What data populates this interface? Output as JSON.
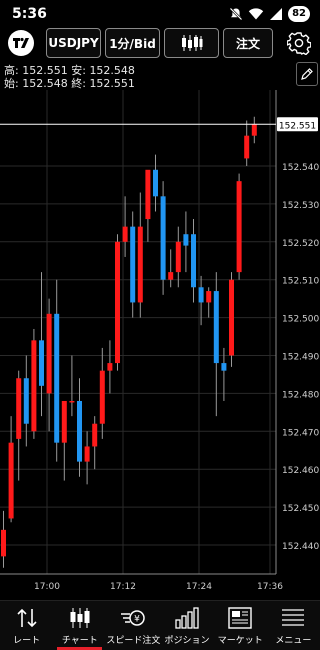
{
  "status": {
    "time": "5:36",
    "battery": "82"
  },
  "toolbar": {
    "symbol": "USDJPY",
    "timeframe": "1分/Bid",
    "order": "注文"
  },
  "ohlc": {
    "high_label": "高:",
    "high": "152.551",
    "low_label": "安:",
    "low": "152.548",
    "open_label": "始:",
    "open": "152.548",
    "close_label": "終:",
    "close": "152.551"
  },
  "colors": {
    "up": "#ff1a1a",
    "down": "#2196f3",
    "grid": "#2a2a2a",
    "accent": "#e6202a"
  },
  "chart_data": {
    "type": "candlestick",
    "current_price": "152.551",
    "y_ticks": [
      "152.540",
      "152.530",
      "152.520",
      "152.510",
      "152.500",
      "152.490",
      "152.480",
      "152.470",
      "152.460",
      "152.450",
      "152.440"
    ],
    "x_ticks": [
      "17:00",
      "17:12",
      "17:24",
      "17:36"
    ],
    "candles": [
      {
        "o": 152.437,
        "h": 152.449,
        "c": 152.444,
        "l": 152.434
      },
      {
        "o": 152.447,
        "h": 152.474,
        "c": 152.467,
        "l": 152.446
      },
      {
        "o": 152.468,
        "h": 152.486,
        "c": 152.484,
        "l": 152.457
      },
      {
        "o": 152.484,
        "h": 152.49,
        "c": 152.472,
        "l": 152.466
      },
      {
        "o": 152.47,
        "h": 152.497,
        "c": 152.494,
        "l": 152.468
      },
      {
        "o": 152.494,
        "h": 152.512,
        "c": 152.482,
        "l": 152.474
      },
      {
        "o": 152.48,
        "h": 152.505,
        "c": 152.501,
        "l": 152.47
      },
      {
        "o": 152.501,
        "h": 152.51,
        "c": 152.467,
        "l": 152.462
      },
      {
        "o": 152.467,
        "h": 152.476,
        "c": 152.478,
        "l": 152.457
      },
      {
        "o": 152.478,
        "h": 152.49,
        "c": 152.478,
        "l": 152.474
      },
      {
        "o": 152.478,
        "h": 152.484,
        "c": 152.462,
        "l": 152.458
      },
      {
        "o": 152.462,
        "h": 152.47,
        "c": 152.466,
        "l": 152.456
      },
      {
        "o": 152.466,
        "h": 152.474,
        "c": 152.472,
        "l": 152.46
      },
      {
        "o": 152.472,
        "h": 152.492,
        "c": 152.486,
        "l": 152.468
      },
      {
        "o": 152.486,
        "h": 152.494,
        "c": 152.488,
        "l": 152.48
      },
      {
        "o": 152.488,
        "h": 152.522,
        "c": 152.52,
        "l": 152.486
      },
      {
        "o": 152.52,
        "h": 152.532,
        "c": 152.524,
        "l": 152.516
      },
      {
        "o": 152.524,
        "h": 152.528,
        "c": 152.504,
        "l": 152.5
      },
      {
        "o": 152.504,
        "h": 152.533,
        "c": 152.524,
        "l": 152.5
      },
      {
        "o": 152.526,
        "h": 152.538,
        "c": 152.539,
        "l": 152.52
      },
      {
        "o": 152.539,
        "h": 152.543,
        "c": 152.532,
        "l": 152.528
      },
      {
        "o": 152.532,
        "h": 152.536,
        "c": 152.51,
        "l": 152.506
      },
      {
        "o": 152.51,
        "h": 152.518,
        "c": 152.512,
        "l": 152.508
      },
      {
        "o": 152.512,
        "h": 152.524,
        "c": 152.52,
        "l": 152.508
      },
      {
        "o": 152.522,
        "h": 152.528,
        "c": 152.519,
        "l": 152.512
      },
      {
        "o": 152.522,
        "h": 152.526,
        "c": 152.508,
        "l": 152.504
      },
      {
        "o": 152.508,
        "h": 152.511,
        "c": 152.504,
        "l": 152.498
      },
      {
        "o": 152.504,
        "h": 152.508,
        "c": 152.507,
        "l": 152.5
      },
      {
        "o": 152.507,
        "h": 152.512,
        "c": 152.488,
        "l": 152.474
      },
      {
        "o": 152.488,
        "h": 152.492,
        "c": 152.486,
        "l": 152.478
      },
      {
        "o": 152.49,
        "h": 152.512,
        "c": 152.51,
        "l": 152.487
      },
      {
        "o": 152.512,
        "h": 152.538,
        "c": 152.536,
        "l": 152.51
      },
      {
        "o": 152.542,
        "h": 152.552,
        "c": 152.548,
        "l": 152.54
      },
      {
        "o": 152.548,
        "h": 152.553,
        "c": 152.551,
        "l": 152.546
      }
    ]
  },
  "nav": [
    {
      "label": "レート",
      "icon": "rate-arrows-icon"
    },
    {
      "label": "チャート",
      "icon": "candlestick-icon"
    },
    {
      "label": "スピード注文",
      "icon": "speed-order-icon"
    },
    {
      "label": "ポジション",
      "icon": "position-bars-icon"
    },
    {
      "label": "マーケット",
      "icon": "news-icon"
    },
    {
      "label": "メニュー",
      "icon": "menu-lines-icon"
    }
  ]
}
